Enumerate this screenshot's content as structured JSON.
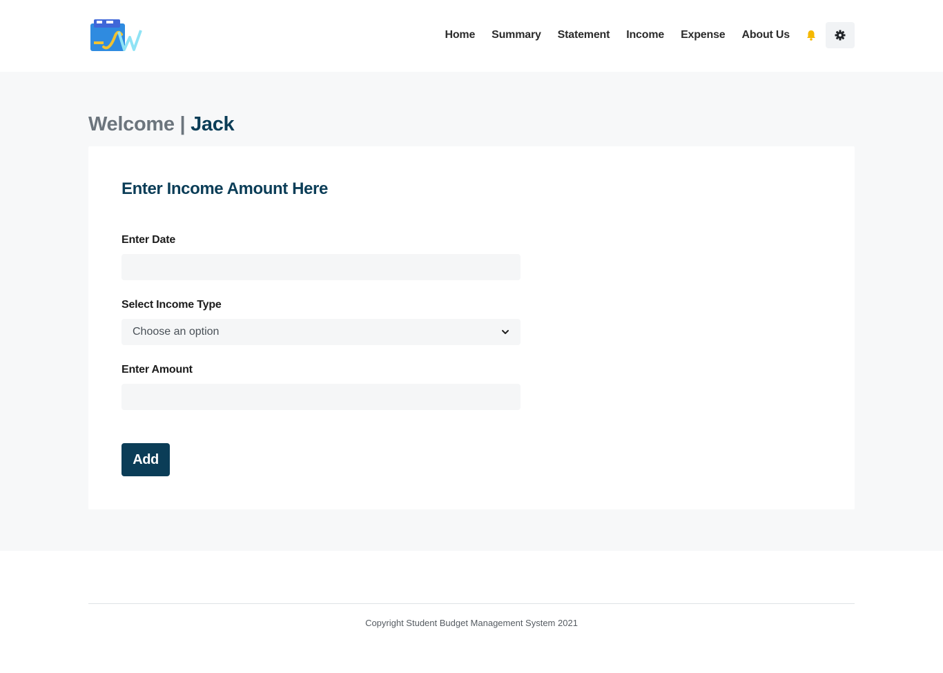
{
  "nav": {
    "logo_icon": "budget-app-logo",
    "links": [
      "Home",
      "Summary",
      "Statement",
      "Income",
      "Expense",
      "About Us"
    ],
    "bell_icon": "bell-icon",
    "settings_icon": "gear-icon",
    "bell_color": "#f5b800"
  },
  "welcome": {
    "prefix": "Welcome",
    "separator": "|",
    "username": "Jack"
  },
  "form": {
    "title": "Enter Income Amount Here",
    "date_label": "Enter Date",
    "date_value": "",
    "type_label": "Select Income Type",
    "type_selected": "Choose an option",
    "amount_label": "Enter Amount",
    "amount_value": "",
    "submit_label": "Add"
  },
  "footer": {
    "copyright": "Copyright Student Budget Management System 2021"
  },
  "colors": {
    "brand": "#0b3d57",
    "page_bg": "#f7f8f9",
    "input_bg": "#f5f6f7"
  }
}
